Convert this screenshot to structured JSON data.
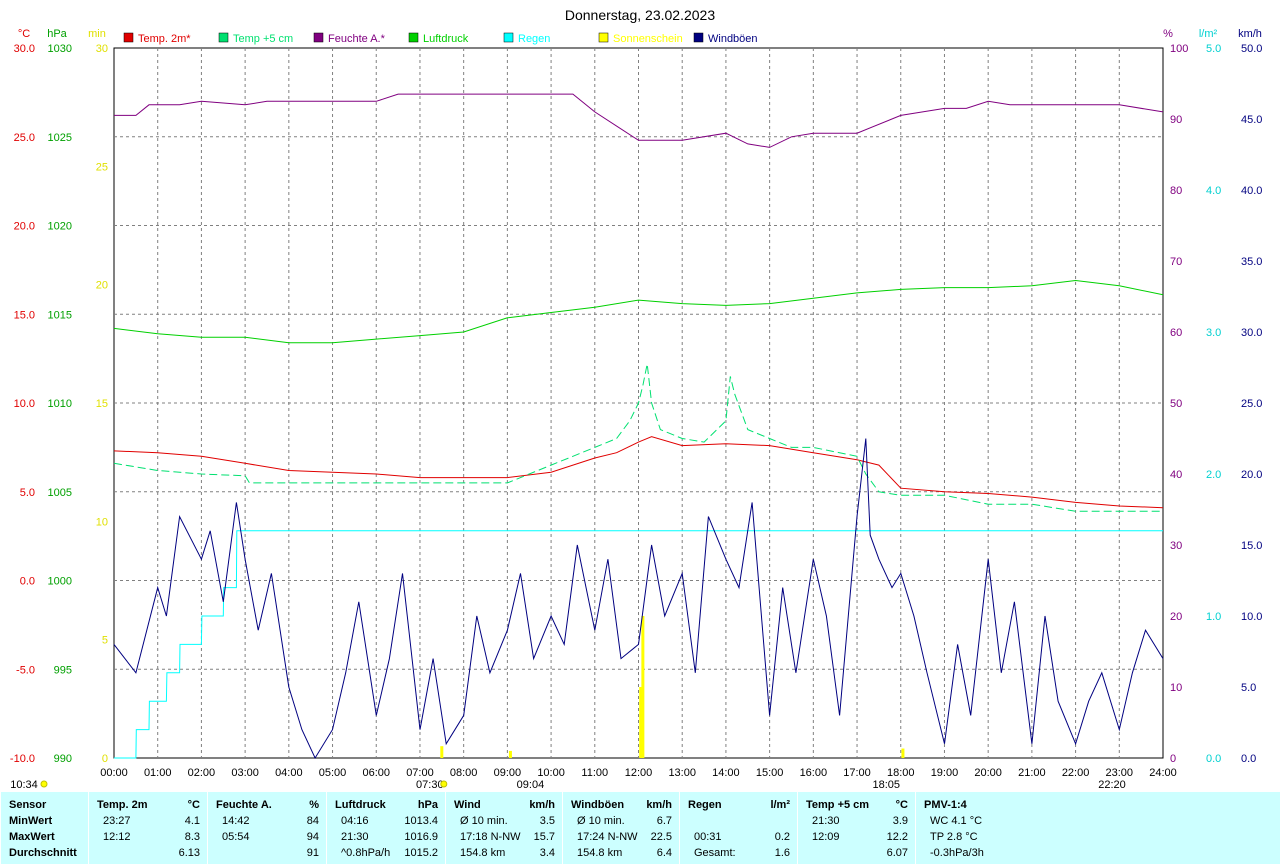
{
  "chart_data": {
    "type": "line",
    "title": "Donnerstag, 23.02.2023",
    "legend": [
      {
        "name": "Temp. 2m*",
        "color": "#e00000"
      },
      {
        "name": "Temp +5 cm",
        "color": "#00e070"
      },
      {
        "name": "Feuchte A.*",
        "color": "#800080"
      },
      {
        "name": "Luftdruck",
        "color": "#00d000"
      },
      {
        "name": "Regen",
        "color": "#00ffff"
      },
      {
        "name": "Sonnenschein",
        "color": "#ffff00"
      },
      {
        "name": "Windböen",
        "color": "#000080"
      }
    ],
    "axes": {
      "temp_c": {
        "unit": "°C",
        "range": [
          -10,
          30
        ],
        "ticks": [
          "30.0",
          "25.0",
          "20.0",
          "15.0",
          "10.0",
          "5.0",
          "0.0",
          "-5.0",
          "-10.0"
        ],
        "color": "#e00000"
      },
      "pressure_hpa": {
        "unit": "hPa",
        "range": [
          990,
          1030
        ],
        "ticks": [
          "1030",
          "1025",
          "1020",
          "1015",
          "1010",
          "1005",
          "1000",
          "995",
          "990"
        ],
        "color": "#00a000"
      },
      "sun_min": {
        "unit": "min",
        "range": [
          0,
          30
        ],
        "ticks": [
          "30",
          "25",
          "20",
          "15",
          "10",
          "5",
          "0"
        ],
        "color": "#e0e000"
      },
      "humidity_pct": {
        "unit": "%",
        "range": [
          0,
          100
        ],
        "ticks": [
          "100",
          "90",
          "80",
          "70",
          "60",
          "50",
          "40",
          "30",
          "20",
          "10",
          "0"
        ],
        "color": "#800080"
      },
      "rain_lm2": {
        "unit": "l/m²",
        "range": [
          0,
          5
        ],
        "ticks": [
          "5.0",
          "4.0",
          "3.0",
          "2.0",
          "1.0",
          "0.0"
        ],
        "color": "#00d0d0"
      },
      "wind_kmh": {
        "unit": "km/h",
        "range": [
          0,
          50
        ],
        "ticks": [
          "50.0",
          "45.0",
          "40.0",
          "35.0",
          "30.0",
          "25.0",
          "20.0",
          "15.0",
          "10.0",
          "5.0",
          "0.0"
        ],
        "color": "#000080"
      }
    },
    "x_ticks": [
      "00:00",
      "01:00",
      "02:00",
      "03:00",
      "04:00",
      "05:00",
      "06:00",
      "07:00",
      "08:00",
      "09:00",
      "10:00",
      "11:00",
      "12:00",
      "13:00",
      "14:00",
      "15:00",
      "16:00",
      "17:00",
      "18:00",
      "19:00",
      "20:00",
      "21:00",
      "22:00",
      "23:00",
      "24:00"
    ],
    "x_range_hours": [
      0,
      24
    ],
    "grid": true,
    "markers": {
      "sunrise_label": "07:30",
      "sunrise_h": 7.5,
      "sun_peak_label": "09:04",
      "sun_peak_h": 9.07,
      "sunset_label": "18:05",
      "sunset_h": 18.08,
      "moon_label": "22:20",
      "moon_h": 22.33,
      "moonrise_label": "10:34"
    },
    "series": [
      {
        "name": "Temp. 2m*",
        "axis": "temp_c",
        "x": [
          0,
          1,
          2,
          3,
          4,
          5,
          6,
          7,
          8,
          9,
          10,
          11,
          11.5,
          12,
          12.3,
          13,
          14,
          15,
          16,
          17,
          17.5,
          18,
          19,
          20,
          21,
          22,
          23,
          24
        ],
        "y": [
          7.3,
          7.2,
          7.0,
          6.6,
          6.2,
          6.1,
          6.0,
          5.8,
          5.8,
          5.8,
          6.1,
          6.9,
          7.2,
          7.8,
          8.1,
          7.6,
          7.7,
          7.6,
          7.2,
          6.8,
          6.5,
          5.2,
          5.0,
          4.9,
          4.7,
          4.4,
          4.2,
          4.1
        ]
      },
      {
        "name": "Temp +5 cm",
        "axis": "temp_c",
        "dashed": true,
        "x": [
          0,
          1,
          2,
          3,
          3.1,
          4,
          5,
          6,
          7,
          8,
          9,
          10,
          10.5,
          11,
          11.5,
          11.8,
          12,
          12.1,
          12.2,
          12.3,
          12.5,
          13,
          13.5,
          14,
          14.1,
          14.2,
          14.5,
          15,
          15.5,
          16,
          17,
          17.2,
          17.5,
          18,
          19,
          20,
          21,
          22,
          23,
          24
        ],
        "y": [
          6.6,
          6.2,
          6.0,
          5.9,
          5.5,
          5.5,
          5.5,
          5.5,
          5.5,
          5.5,
          5.5,
          6.5,
          7.0,
          7.5,
          8.0,
          9.0,
          10.0,
          11.0,
          12.2,
          10.0,
          8.5,
          8.0,
          7.8,
          9.0,
          11.5,
          10.5,
          8.5,
          8.0,
          7.5,
          7.5,
          7.0,
          6.0,
          5.0,
          4.8,
          4.8,
          4.3,
          4.3,
          3.9,
          3.9,
          3.9
        ]
      },
      {
        "name": "Feuchte A.*",
        "axis": "humidity_pct",
        "x": [
          0,
          0.5,
          0.8,
          1.5,
          2,
          3,
          3.5,
          4,
          5,
          6,
          6.5,
          7,
          8,
          9,
          10,
          10.5,
          11,
          12,
          12.5,
          13,
          14,
          14.5,
          15,
          15.5,
          16,
          17,
          18,
          19,
          19.5,
          20,
          20.5,
          21,
          22,
          23,
          24
        ],
        "y": [
          90.5,
          90.5,
          92,
          92,
          92.5,
          92,
          92.5,
          92.5,
          92.5,
          92.5,
          93.5,
          93.5,
          93.5,
          93.5,
          93.5,
          93.5,
          91,
          87,
          87,
          87,
          88,
          86.5,
          86,
          87.5,
          88,
          88,
          90.5,
          91.5,
          91.5,
          92.5,
          92,
          92,
          92,
          92,
          91
        ]
      },
      {
        "name": "Luftdruck",
        "axis": "pressure_hpa",
        "x": [
          0,
          1,
          2,
          3,
          4,
          5,
          6,
          7,
          8,
          9,
          10,
          11,
          12,
          13,
          14,
          15,
          16,
          17,
          18,
          19,
          20,
          21,
          22,
          23,
          24
        ],
        "y": [
          1014.2,
          1013.9,
          1013.7,
          1013.7,
          1013.4,
          1013.4,
          1013.6,
          1013.8,
          1014.0,
          1014.8,
          1015.1,
          1015.4,
          1015.8,
          1015.6,
          1015.5,
          1015.6,
          1015.9,
          1016.2,
          1016.4,
          1016.5,
          1016.5,
          1016.6,
          1016.9,
          1016.6,
          1016.1
        ]
      },
      {
        "name": "Regen",
        "axis": "rain_lm2",
        "x": [
          0,
          0.5,
          0.51,
          0.8,
          0.81,
          1.2,
          1.21,
          1.5,
          1.51,
          2.0,
          2.01,
          2.5,
          2.51,
          2.8,
          2.81,
          24
        ],
        "y": [
          0.0,
          0.0,
          0.2,
          0.2,
          0.4,
          0.4,
          0.6,
          0.6,
          0.8,
          0.8,
          1.0,
          1.0,
          1.2,
          1.2,
          1.6,
          1.6
        ]
      },
      {
        "name": "Windböen",
        "axis": "wind_kmh",
        "x": [
          0,
          0.5,
          1,
          1.2,
          1.5,
          2,
          2.2,
          2.5,
          2.8,
          3,
          3.3,
          3.6,
          4,
          4.3,
          4.6,
          5,
          5.3,
          5.6,
          6,
          6.3,
          6.6,
          7,
          7.3,
          7.6,
          8,
          8.3,
          8.6,
          9,
          9.3,
          9.6,
          10,
          10.3,
          10.6,
          11,
          11.3,
          11.6,
          12,
          12.3,
          12.6,
          13,
          13.3,
          13.6,
          14,
          14.3,
          14.6,
          15,
          15.3,
          15.6,
          16,
          16.3,
          16.6,
          17,
          17.2,
          17.3,
          17.5,
          17.8,
          18,
          18.3,
          18.6,
          19,
          19.3,
          19.6,
          20,
          20.3,
          20.6,
          21,
          21.3,
          21.6,
          22,
          22.3,
          22.6,
          23,
          23.3,
          23.6,
          24
        ],
        "y": [
          8,
          6,
          12,
          10,
          17,
          14,
          16,
          11,
          18,
          14,
          9,
          13,
          5,
          2,
          0,
          2,
          6,
          11,
          3,
          7,
          13,
          2,
          7,
          1,
          3,
          10,
          6,
          9,
          13,
          7,
          10,
          8,
          15,
          9,
          14,
          7,
          8,
          15,
          10,
          13,
          6,
          17,
          14,
          12,
          18,
          3,
          12,
          6,
          14,
          10,
          3,
          17,
          22.5,
          15.7,
          14,
          12,
          13,
          10,
          6,
          1,
          8,
          3,
          14,
          6,
          11,
          1,
          10,
          4,
          1,
          4,
          6,
          2,
          6,
          9,
          7
        ]
      }
    ],
    "sun_bars": [
      {
        "h": 7.5,
        "min": 0.5
      },
      {
        "h": 9.07,
        "min": 0.3
      },
      {
        "h": 12.05,
        "min": 3.0
      },
      {
        "h": 12.1,
        "min": 6.0
      },
      {
        "h": 18.05,
        "min": 0.4
      }
    ]
  },
  "stats": {
    "columns": [
      {
        "title": "Sensor",
        "unit": "",
        "rows": [
          [
            "MinWert",
            ""
          ],
          [
            "MaxWert",
            ""
          ],
          [
            "Durchschnitt",
            ""
          ]
        ]
      },
      {
        "title": "Temp. 2m",
        "unit": "°C",
        "rows": [
          [
            "23:27",
            "4.1"
          ],
          [
            "12:12",
            "8.3"
          ],
          [
            "",
            "6.13"
          ]
        ]
      },
      {
        "title": "Feuchte A.",
        "unit": "%",
        "rows": [
          [
            "14:42",
            "84"
          ],
          [
            "05:54",
            "94"
          ],
          [
            "",
            "91"
          ]
        ]
      },
      {
        "title": "Luftdruck",
        "unit": "hPa",
        "rows": [
          [
            "04:16",
            "1013.4"
          ],
          [
            "21:30",
            "1016.9"
          ],
          [
            "^0.8hPa/h",
            "1015.2"
          ]
        ]
      },
      {
        "title": "Wind",
        "unit": "km/h",
        "rows": [
          [
            "Ø 10 min.",
            "3.5"
          ],
          [
            "17:18   N-NW",
            "15.7"
          ],
          [
            "154.8 km",
            "3.4"
          ]
        ]
      },
      {
        "title": "Windböen",
        "unit": "km/h",
        "rows": [
          [
            "Ø 10 min.",
            "6.7"
          ],
          [
            "17:24   N-NW",
            "22.5"
          ],
          [
            "154.8 km",
            "6.4"
          ]
        ]
      },
      {
        "title": "Regen",
        "unit": "l/m²",
        "rows": [
          [
            "",
            ""
          ],
          [
            "00:31",
            "0.2"
          ],
          [
            "Gesamt:",
            "1.6"
          ]
        ]
      },
      {
        "title": "Temp +5 cm",
        "unit": "°C",
        "rows": [
          [
            "21:30",
            "3.9"
          ],
          [
            "12:09",
            "12.2"
          ],
          [
            "",
            "6.07"
          ]
        ]
      },
      {
        "title": "PMV-1:4",
        "unit": "",
        "rows": [
          [
            "WC 4.1 °C",
            ""
          ],
          [
            "TP 2.8 °C",
            ""
          ],
          [
            "-0.3hPa/3h",
            ""
          ]
        ]
      }
    ]
  }
}
